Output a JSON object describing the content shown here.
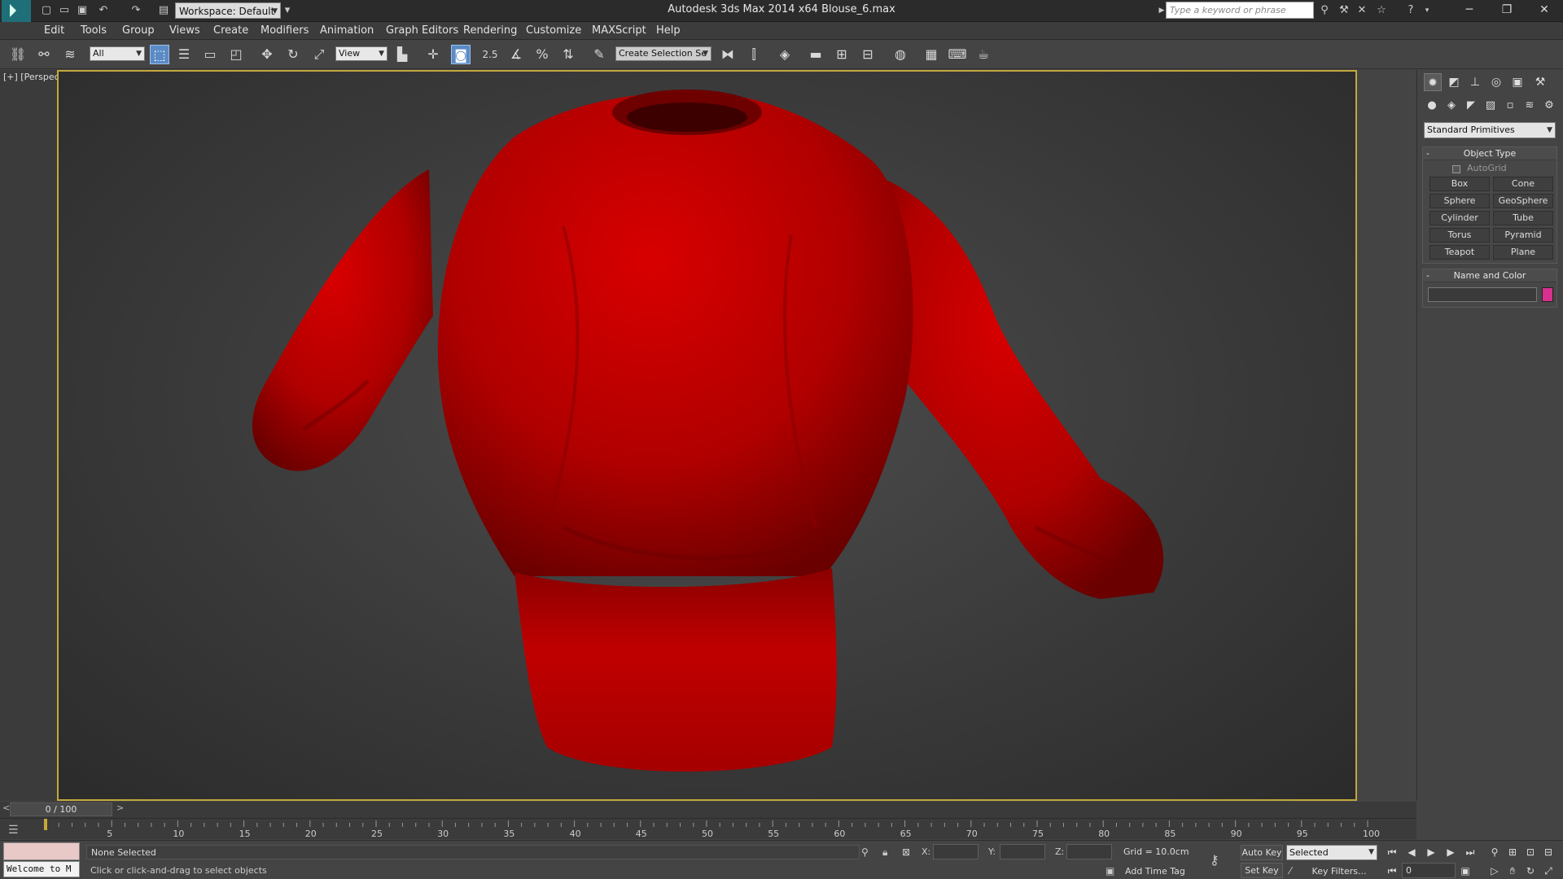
{
  "titlebar": {
    "workspace": "Workspace: Default",
    "title": "Autodesk 3ds Max  2014 x64    Blouse_6.max",
    "search_placeholder": "Type a keyword or phrase"
  },
  "menu": [
    "Edit",
    "Tools",
    "Group",
    "Views",
    "Create",
    "Modifiers",
    "Animation",
    "Graph Editors",
    "Rendering",
    "Customize",
    "MAXScript",
    "Help"
  ],
  "toolbar": {
    "selection_filter": "All",
    "ref_coord": "View",
    "snap_label": "2.5",
    "named_selection": "Create Selection Se"
  },
  "viewport": {
    "label": "[+] [Perspective ] [Shaded ]",
    "object_color": "#d00000",
    "border_color": "#c3a73c"
  },
  "command_panel": {
    "category": "Standard Primitives",
    "object_type_title": "Object Type",
    "autogrid": "AutoGrid",
    "buttons": [
      "Box",
      "Cone",
      "Sphere",
      "GeoSphere",
      "Cylinder",
      "Tube",
      "Torus",
      "Pyramid",
      "Teapot",
      "Plane"
    ],
    "name_color_title": "Name and Color",
    "swatch_color": "#d8308f"
  },
  "timeline": {
    "slider": "0 / 100",
    "ticks": [
      5,
      10,
      15,
      20,
      25,
      30,
      35,
      40,
      45,
      50,
      55,
      60,
      65,
      70,
      75,
      80,
      85,
      90,
      95,
      100
    ]
  },
  "status": {
    "welcome": "Welcome to M",
    "selection": "None Selected",
    "prompt": "Click or click-and-drag to select objects",
    "x_label": "X:",
    "y_label": "Y:",
    "z_label": "Z:",
    "grid": "Grid = 10.0cm",
    "add_time_tag": "Add Time Tag",
    "auto_key": "Auto Key",
    "set_key": "Set Key",
    "key_mode": "Selected",
    "key_filters": "Key Filters...",
    "frame": "0"
  }
}
